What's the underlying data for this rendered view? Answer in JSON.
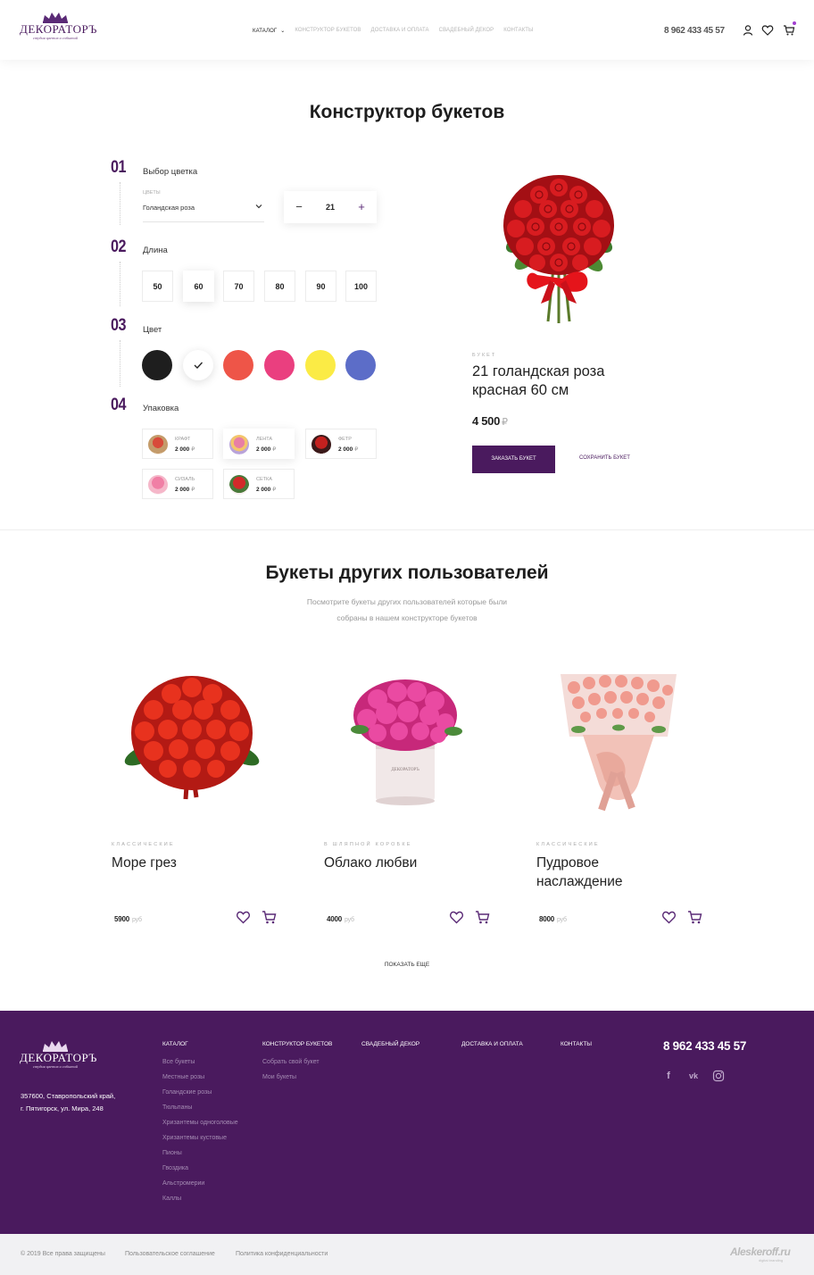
{
  "brand": {
    "name": "ДЕКОРАТОРЪ",
    "tagline": "студия цветов и событий"
  },
  "nav": {
    "items": [
      {
        "label": "КАТАЛОГ"
      },
      {
        "label": "КОНСТРУКТОР БУКЕТОВ"
      },
      {
        "label": "ДОСТАВКА И ОПЛАТА"
      },
      {
        "label": "СВАДЕБНЫЙ ДЕКОР"
      },
      {
        "label": "КОНТАКТЫ"
      }
    ],
    "phone": "8 962 433 45 57",
    "icons": [
      "user-icon",
      "heart-icon",
      "cart-icon"
    ]
  },
  "constructor": {
    "title": "Конструктор букетов",
    "steps": [
      {
        "num": "01",
        "label": "Выбор цветка"
      },
      {
        "num": "02",
        "label": "Длина"
      },
      {
        "num": "03",
        "label": "Цвет"
      },
      {
        "num": "04",
        "label": "Упаковка"
      }
    ],
    "flower_select": {
      "label": "ЦВЕТЫ",
      "value": "Голандская роза"
    },
    "quantity": "21",
    "lengths": [
      "50",
      "60",
      "70",
      "80",
      "90",
      "100"
    ],
    "selected_length": "60",
    "colors": [
      {
        "name": "black",
        "hex": "#1e1e1e"
      },
      {
        "name": "white",
        "hex": "#ffffff"
      },
      {
        "name": "red",
        "hex": "#ee5548"
      },
      {
        "name": "pink",
        "hex": "#ea3f7f"
      },
      {
        "name": "yellow",
        "hex": "#fbeb45"
      },
      {
        "name": "blue",
        "hex": "#5c6dc8"
      }
    ],
    "selected_color": "white",
    "packaging": [
      {
        "name": "КРАФТ",
        "price": "2 000",
        "currency": "₽"
      },
      {
        "name": "ЛЕНТА",
        "price": "2 000",
        "currency": "₽"
      },
      {
        "name": "ФЕТР",
        "price": "2 000",
        "currency": "₽"
      },
      {
        "name": "СИЗАЛЬ",
        "price": "2 000",
        "currency": "₽"
      },
      {
        "name": "СЕТКА",
        "price": "2 000",
        "currency": "₽"
      }
    ],
    "result": {
      "category": "БУКЕТ",
      "name": "21 голандская роза красная  60 см",
      "price": "4 500",
      "currency": "₽",
      "order_label": "ЗАКАЗАТЬ БУКЕТ",
      "save_label": "СОХРАНИТЬ БУКЕТ"
    }
  },
  "others": {
    "title": "Букеты других пользователей",
    "subtitle_line1": "Посмотрите букеты других пользователей которые были",
    "subtitle_line2": "собраны в нашем конструкторе букетов",
    "cards": [
      {
        "category": "КЛАССИЧЕСКИЕ",
        "name": "Море грез",
        "price": "5900",
        "currency": "руб"
      },
      {
        "category": "В ШЛЯПНОЙ КОРОБКЕ",
        "name": "Облако любви",
        "price": "4000",
        "currency": "руб"
      },
      {
        "category": "КЛАССИЧЕСКИЕ",
        "name": "Пудровое наслаждение",
        "price": "8000",
        "currency": "руб"
      }
    ],
    "show_more": "ПОКАЗАТЬ ЕЩЕ"
  },
  "footer": {
    "address_line1": "357600, Ставропольский край,",
    "address_line2": "г. Пятигорск, ул. Мира, 248",
    "columns": [
      {
        "title": "КАТАЛОГ",
        "links": [
          "Все букеты",
          "Местные розы",
          "Голандские розы",
          "Тюльпаны",
          "Хризантемы одноголовые",
          "Хризантемы кустовые",
          "Пионы",
          "Гвоздика",
          "Альстромерии",
          "Каллы"
        ]
      },
      {
        "title": "КОНСТРУКТОР БУКЕТОВ",
        "links": [
          "Собрать свой букет",
          "Мои букеты"
        ]
      },
      {
        "title": "СВАДЕБНЫЙ ДЕКОР",
        "links": []
      },
      {
        "title": "ДОСТАВКА И ОПЛАТА",
        "links": []
      },
      {
        "title": "КОНТАКТЫ",
        "links": []
      }
    ],
    "phone": "8 962 433 45 57",
    "social": [
      {
        "icon": "facebook-icon",
        "glyph": "f"
      },
      {
        "icon": "vk-icon",
        "glyph": "vk"
      },
      {
        "icon": "instagram-icon",
        "glyph": "◎"
      }
    ]
  },
  "bottom": {
    "copyright": "© 2019 Все права защищены",
    "agreement": "Пользовательское соглашение",
    "privacy": "Политика конфиденциальности",
    "brand": "Aleskeroff.ru",
    "brand_sub": "digital branding"
  }
}
